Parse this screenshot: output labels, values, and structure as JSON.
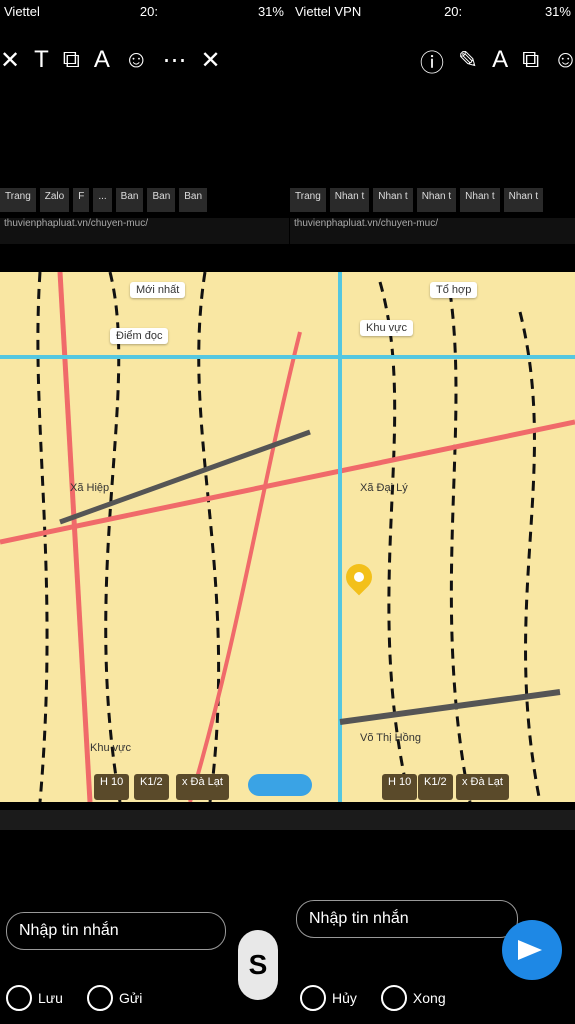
{
  "status_left": {
    "carrier": "Viettel",
    "time": "20:",
    "battery": "31%"
  },
  "status_right": {
    "carrier": "Viettel VPN",
    "time": "20:",
    "battery": "31%"
  },
  "topbar_left": [
    "close-icon",
    "text-icon",
    "crop-icon",
    "font-icon",
    "sticker-icon",
    "more-icon",
    "close-icon"
  ],
  "topbar_right": [
    "info-icon",
    "draw-icon",
    "font-icon",
    "crop-icon",
    "sticker-icon"
  ],
  "tabs_left": [
    "Trang",
    "Zalo",
    "F",
    "...",
    "x",
    "Ban",
    "Ban",
    "Ban",
    "x"
  ],
  "tabs_right": [
    "Trang",
    "Nhan t",
    "Nhan t",
    "Nhan t",
    "Nhan t",
    "Nhan t"
  ],
  "url_left": "thuvienphapluat.vn/chuyen-muc/",
  "url_right": "thuvienphapluat.vn/chuyen-muc/",
  "map": {
    "chips": [
      {
        "text": "Mới nhất"
      },
      {
        "text": "Điểm đọc"
      },
      {
        "text": "Khu vực"
      },
      {
        "text": "Tổ hợp"
      }
    ],
    "labels": [
      {
        "text": "Võ Thị Hồng"
      },
      {
        "text": "Xã Đại Lý"
      },
      {
        "text": "Xã Hiệp"
      },
      {
        "text": "Khu vực"
      }
    ]
  },
  "bottom_chips_left": [
    "H 10",
    "K1/2",
    "x Đà Lạt"
  ],
  "bottom_chips_right": [
    "H 10",
    "K1/2",
    "x Đà Lạt"
  ],
  "input_left": {
    "value": "Nhập tin nhắn"
  },
  "input_right": {
    "value": "Nhập tin nhắn"
  },
  "nav_left": [
    "Lưu",
    "Gửi"
  ],
  "nav_right": [
    "Hủy",
    "Xong"
  ],
  "colors": {
    "map_bg": "#f9e7a3",
    "accent": "#1e88e5"
  }
}
